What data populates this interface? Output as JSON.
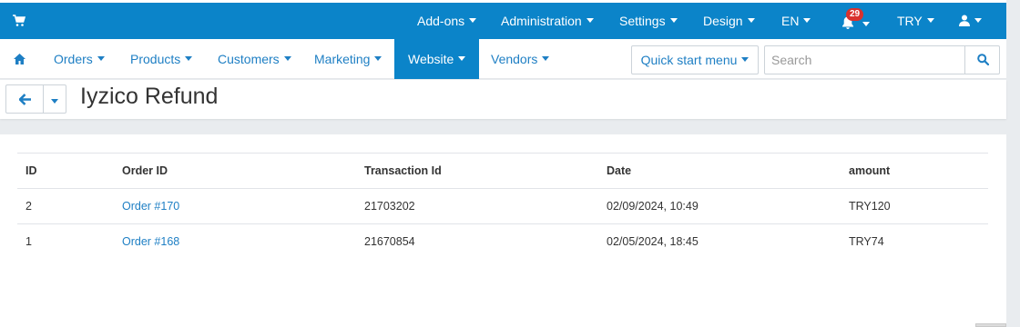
{
  "topbar": {
    "addons": "Add-ons",
    "administration": "Administration",
    "settings": "Settings",
    "design": "Design",
    "language": "EN",
    "notifications_count": "29",
    "currency": "TRY"
  },
  "nav": {
    "orders": "Orders",
    "products": "Products",
    "customers": "Customers",
    "marketing": "Marketing",
    "website": "Website",
    "vendors": "Vendors",
    "quick_start": "Quick start menu",
    "search_placeholder": "Search"
  },
  "page": {
    "title": "Iyzico Refund"
  },
  "table": {
    "headers": [
      "ID",
      "Order ID",
      "Transaction Id",
      "Date",
      "amount"
    ],
    "rows": [
      {
        "id": "2",
        "order": "Order #170",
        "transaction": "21703202",
        "date": "02/09/2024, 10:49",
        "amount": "TRY120"
      },
      {
        "id": "1",
        "order": "Order #168",
        "transaction": "21670854",
        "date": "02/05/2024, 18:45",
        "amount": "TRY74"
      }
    ]
  },
  "colors": {
    "brand": "#0b84c9",
    "link": "#1e7fc4",
    "badge": "#d9322e"
  }
}
